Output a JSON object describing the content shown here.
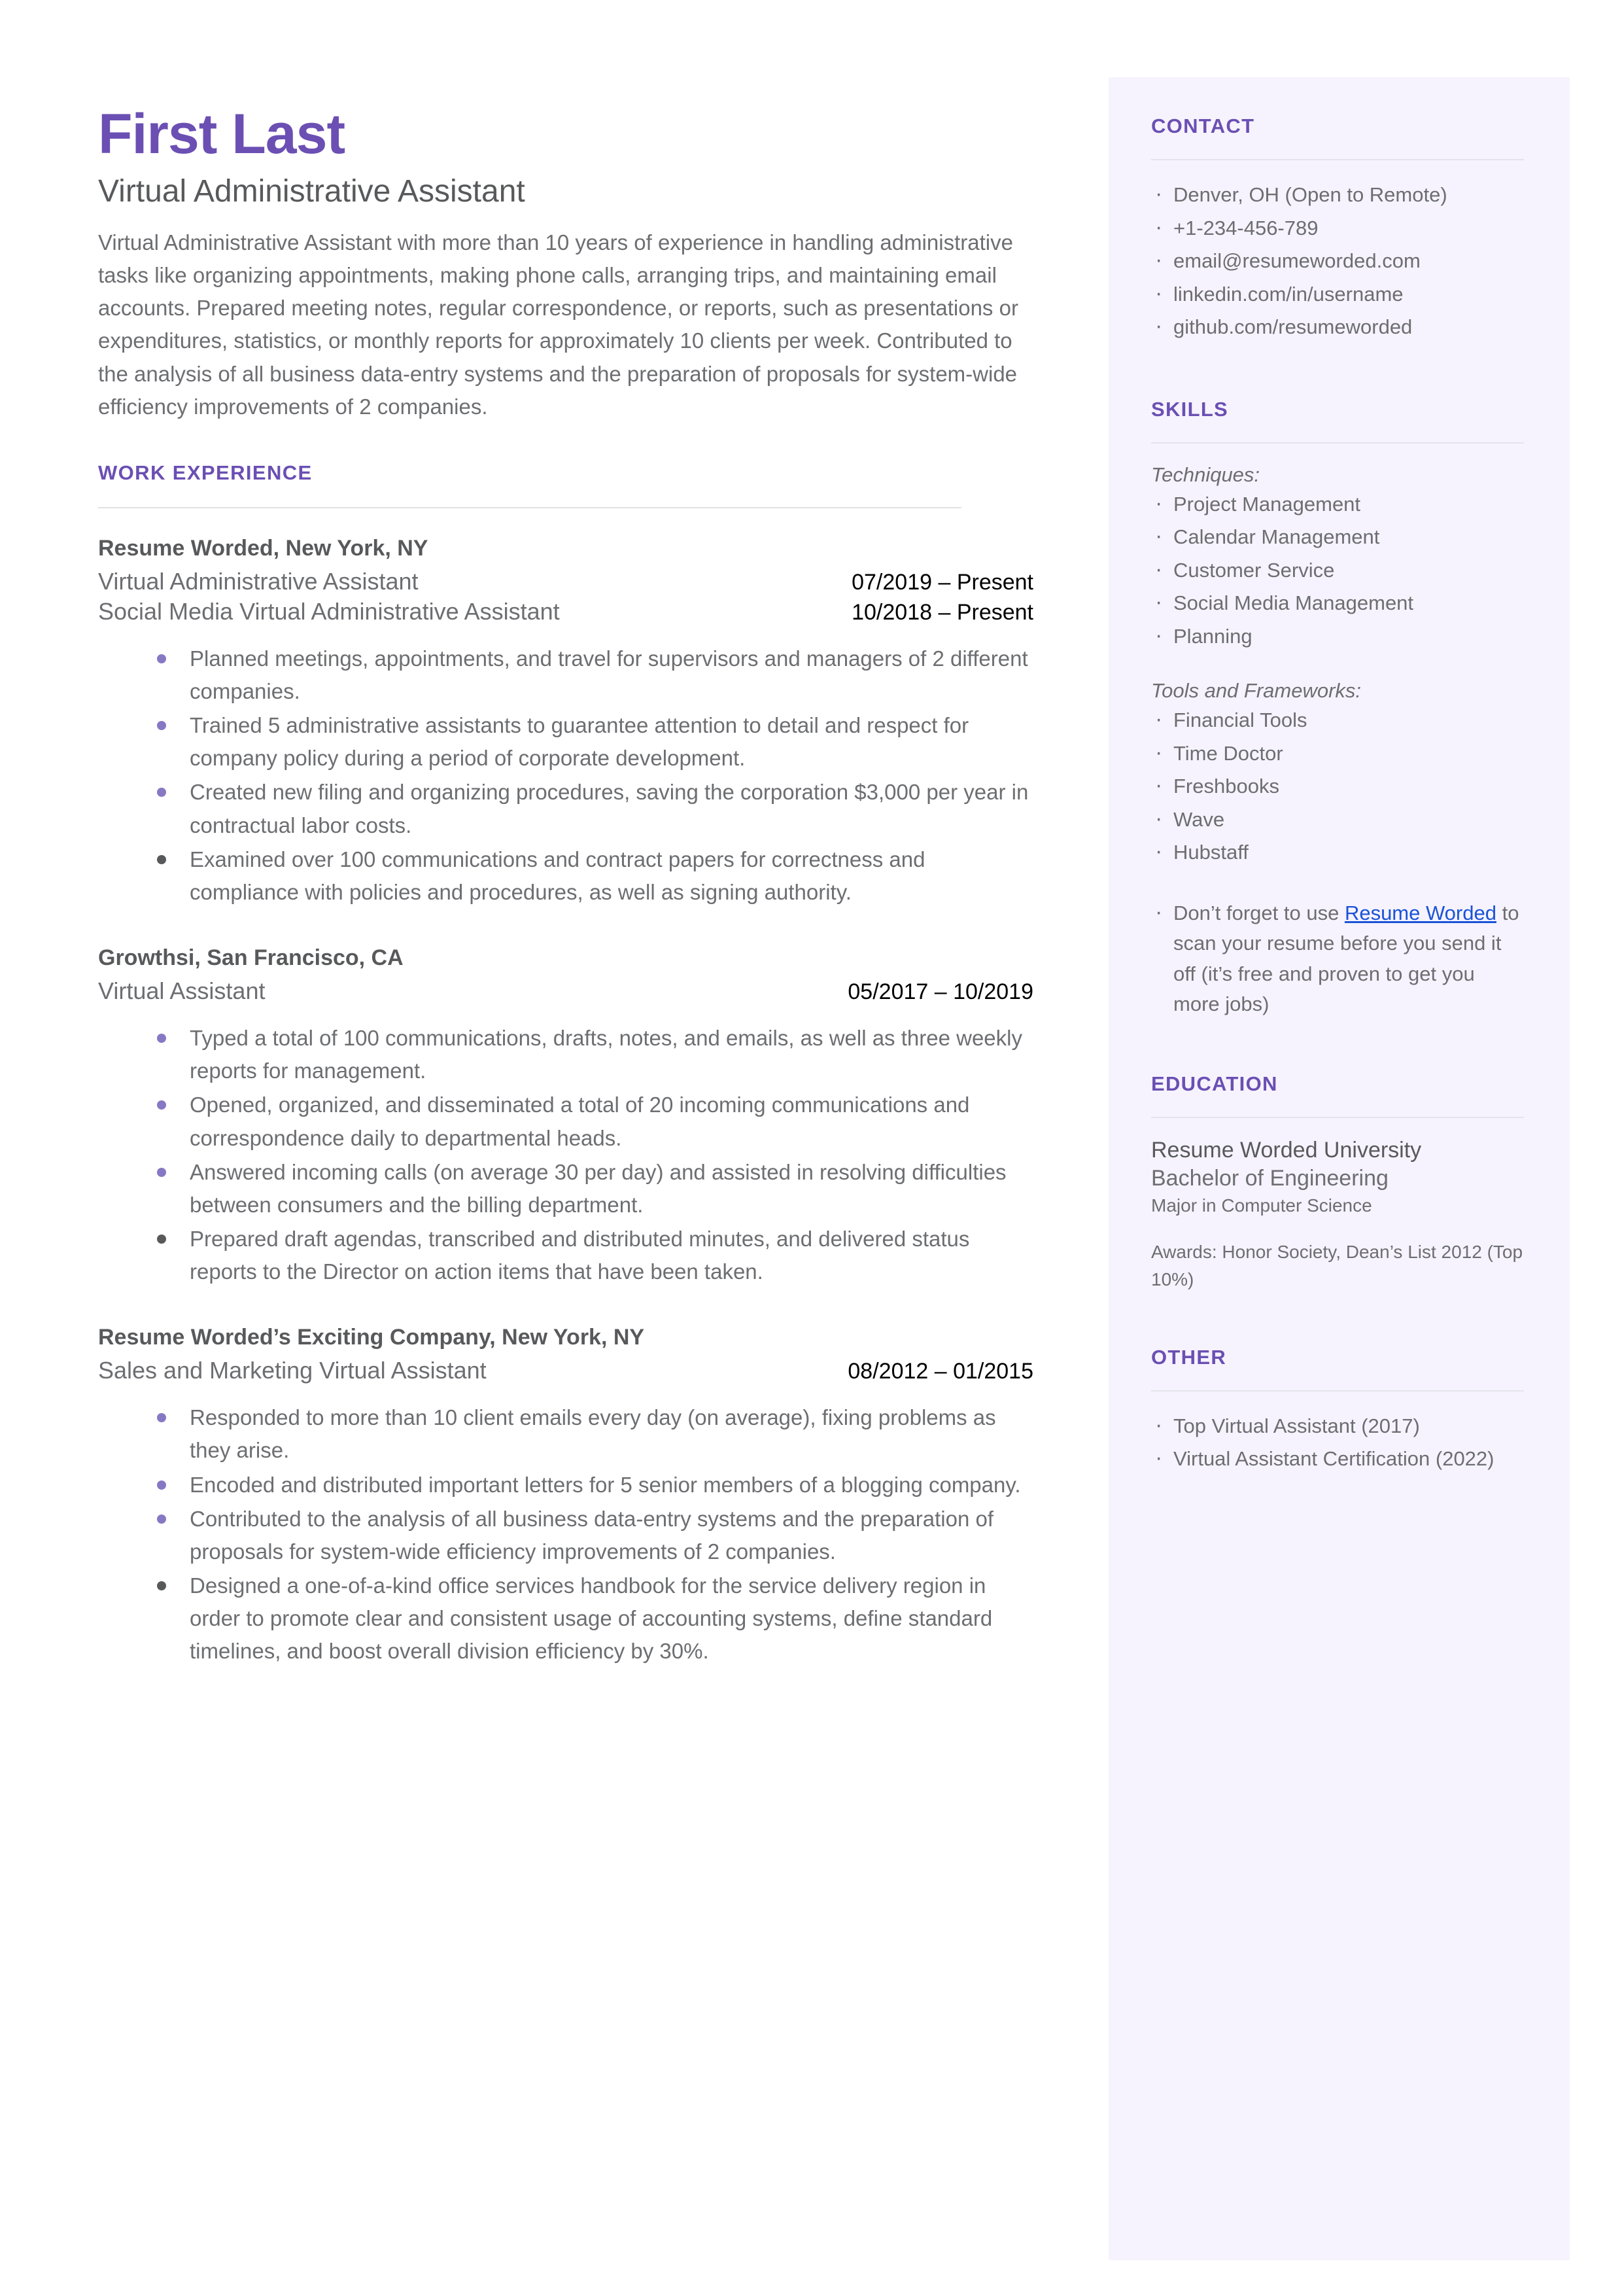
{
  "theme": {
    "accent": "#6b4fb3",
    "sidebar_bg": "#f6f3fe",
    "body_text": "#6d6e71",
    "heading_text": "#58595b",
    "bullet": "#8878c3",
    "bullet_dark": "#58595b",
    "link": "#1a53d6",
    "rule": "#e2e2e4"
  },
  "header": {
    "name": "First Last",
    "headline": "Virtual Administrative Assistant",
    "summary": "Virtual Administrative Assistant with more than 10 years of experience in handling administrative tasks like organizing appointments, making phone calls, arranging trips, and maintaining email accounts. Prepared meeting notes, regular correspondence, or reports, such as presentations or expenditures, statistics, or monthly reports for approximately 10 clients per week. Contributed to the analysis of all business data-entry systems and the preparation of proposals for system-wide efficiency improvements of 2 companies."
  },
  "work": {
    "section_title": "WORK EXPERIENCE",
    "jobs": [
      {
        "company": "Resume Worded, New York, NY",
        "roles": [
          {
            "title": "Virtual Administrative Assistant",
            "dates": "07/2019 – Present"
          },
          {
            "title": "Social Media Virtual Administrative Assistant",
            "dates": "10/2018 – Present"
          }
        ],
        "bullets": [
          "Planned meetings, appointments, and travel for supervisors and managers of 2 different companies.",
          "Trained 5 administrative assistants to guarantee attention to detail and respect for company policy during a period of corporate development.",
          "Created new filing and organizing procedures, saving the corporation $3,000 per year in contractual labor costs.",
          "Examined over 100 communications and contract papers for correctness and compliance with policies and procedures, as well as signing authority."
        ]
      },
      {
        "company": "Growthsi, San Francisco, CA",
        "roles": [
          {
            "title": "Virtual Assistant",
            "dates": "05/2017 – 10/2019"
          }
        ],
        "bullets": [
          "Typed a total of 100 communications, drafts, notes, and emails, as well as three weekly reports for management.",
          "Opened, organized, and disseminated a total of 20 incoming communications and correspondence daily to departmental heads.",
          "Answered incoming calls (on average 30 per day) and assisted in resolving difficulties between consumers and the billing department.",
          "Prepared draft agendas, transcribed and distributed minutes, and delivered status reports to the Director on action items that have been taken."
        ]
      },
      {
        "company": "Resume Worded’s Exciting Company, New York, NY",
        "roles": [
          {
            "title": "Sales and Marketing Virtual Assistant",
            "dates": "08/2012 – 01/2015"
          }
        ],
        "bullets": [
          "Responded to more than 10 client emails every day (on average), fixing problems as they arise.",
          "Encoded and distributed important letters for 5 senior members of a blogging company.",
          "Contributed to the analysis of all business data-entry systems and the preparation of proposals for system-wide efficiency improvements of 2 companies.",
          "Designed a one-of-a-kind office services handbook for the service delivery region in order to promote clear and consistent usage of accounting systems, define standard timelines, and boost overall division efficiency by 30%."
        ]
      }
    ]
  },
  "contact": {
    "section_title": "CONTACT",
    "items": [
      "Denver, OH (Open to Remote)",
      "+1-234-456-789",
      "email@resumeworded.com",
      "linkedin.com/in/username",
      "github.com/resumeworded"
    ]
  },
  "skills": {
    "section_title": "SKILLS",
    "groups": [
      {
        "label": "Techniques:",
        "items": [
          "Project Management",
          "Calendar Management",
          "Customer Service",
          "Social Media Management",
          "Planning"
        ]
      },
      {
        "label": "Tools and Frameworks:",
        "items": [
          "Financial Tools",
          "Time Doctor",
          "Freshbooks",
          "Wave",
          "Hubstaff"
        ]
      }
    ],
    "note_before": "Don’t forget to use ",
    "note_link": "Resume Worded",
    "note_after": " to scan your resume before you send it off (it’s free and proven to get you more jobs)"
  },
  "education": {
    "section_title": "EDUCATION",
    "school": "Resume Worded University",
    "degree": "Bachelor of Engineering",
    "major": "Major in Computer Science",
    "awards": "Awards: Honor Society, Dean’s List 2012 (Top 10%)"
  },
  "other": {
    "section_title": "OTHER",
    "items": [
      "Top Virtual Assistant (2017)",
      "Virtual Assistant Certification (2022)"
    ]
  }
}
